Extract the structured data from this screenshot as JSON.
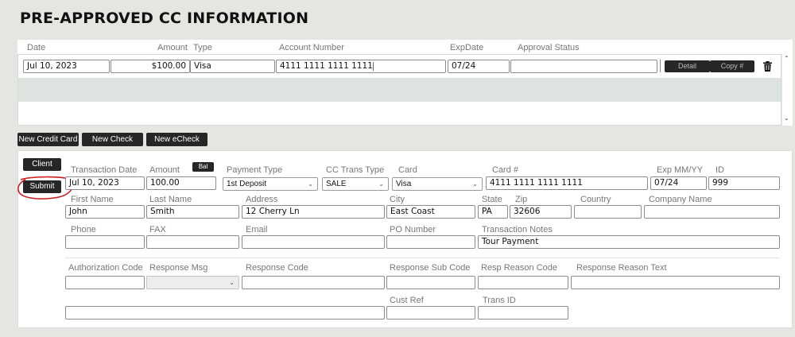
{
  "page": {
    "title": "PRE-APPROVED CC INFORMATION"
  },
  "list": {
    "headers": {
      "date": "Date",
      "amount": "Amount",
      "type": "Type",
      "account": "Account Number",
      "exp": "ExpDate",
      "approval": "Approval Status"
    },
    "row": {
      "date": "Jul 10, 2023",
      "amount": "$100.00",
      "type": "Visa",
      "account": "4111 1111 1111 1111",
      "exp": "07/24",
      "approval": "",
      "detail_label": "Detail",
      "copy_label": "Copy #"
    }
  },
  "actions": {
    "new_credit_card": "New Credit Card",
    "new_check": "New Check",
    "new_echeck": "New eCheck"
  },
  "form": {
    "client_label": "Client",
    "submit_label": "Submit",
    "bal_label": "Bal",
    "labels": {
      "trans_date": "Transaction Date",
      "amount": "Amount",
      "payment_type": "Payment Type",
      "cc_trans_type": "CC Trans Type",
      "card": "Card",
      "card_no": "Card #",
      "exp": "Exp MM/YY",
      "id": "ID",
      "first_name": "First Name",
      "last_name": "Last Name",
      "address": "Address",
      "city": "City",
      "state": "State",
      "zip": "Zip",
      "country": "Country",
      "company": "Company Name",
      "phone": "Phone",
      "fax": "FAX",
      "email": "Email",
      "po": "PO Number",
      "notes": "Transaction Notes",
      "auth_code": "Authorization Code",
      "resp_msg": "Response Msg",
      "resp_code": "Response Code",
      "resp_sub_code": "Response Sub Code",
      "resp_reason_code": "Resp Reason Code",
      "resp_reason_text": "Response Reason Text",
      "cust_ref": "Cust Ref",
      "trans_id": "Trans ID"
    },
    "values": {
      "trans_date": "Jul 10, 2023",
      "amount": "100.00",
      "payment_type": "1st Deposit",
      "cc_trans_type": "SALE",
      "card": "Visa",
      "card_no": "4111 1111 1111 1111",
      "exp": "07/24",
      "id": "999",
      "first_name": "John",
      "last_name": "Smith",
      "address": "12 Cherry Ln",
      "city": "East Coast",
      "state": "PA",
      "zip": "32606",
      "country": "",
      "company": "",
      "phone": "",
      "fax": "",
      "email": "",
      "po": "",
      "notes": "Tour Payment",
      "auth_code": "",
      "resp_msg": "",
      "resp_code": "",
      "resp_sub_code": "",
      "resp_reason_code": "",
      "resp_reason_text": "",
      "blank_field": "",
      "cust_ref": "",
      "trans_id": ""
    }
  },
  "icons": {
    "trash": "trash-icon",
    "chevron": "chevron-down-icon"
  },
  "colors": {
    "annotation_circle": "#d11a1a",
    "dark_button": "#262626",
    "empty_row": "#dde3df"
  }
}
